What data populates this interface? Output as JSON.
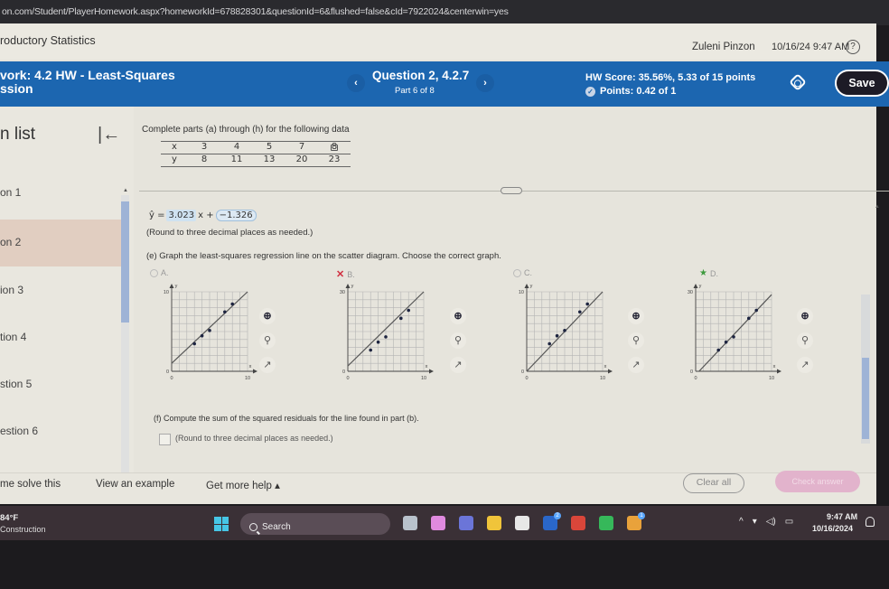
{
  "browser": {
    "url": "on.com/Student/PlayerHomework.aspx?homeworkId=678828301&questionId=6&flushed=false&cId=7922024&centerwin=yes"
  },
  "course_bar": {
    "title": "roductory Statistics",
    "user": "Zuleni Pinzon",
    "datetime": "10/16/24 9:47 AM",
    "help_glyph": "?"
  },
  "hw_bar": {
    "title_line1": "vork:  4.2 HW - Least-Squares",
    "title_line2": "ssion",
    "prev_glyph": "‹",
    "next_glyph": "›",
    "question": "Question 2, 4.2.7",
    "part": "Part 6 of 8",
    "hw_score": "HW Score: 35.56%, 5.33 of 15 points",
    "points": "Points: 0.42 of 1",
    "points_icon": "partial-credit-icon",
    "save_label": "Save",
    "accent": "#1c66b0"
  },
  "sidebar": {
    "title": "n list",
    "collapse_glyph": "|←",
    "items": [
      {
        "label": "on 1",
        "active": false
      },
      {
        "label": "on 2",
        "active": true
      },
      {
        "label": "ion 3",
        "active": false
      },
      {
        "label": "tion 4",
        "active": false
      },
      {
        "label": "stion 5",
        "active": false
      },
      {
        "label": "estion 6",
        "active": false
      }
    ]
  },
  "question": {
    "prompt": "Complete parts (a) through (h) for the following data",
    "table": {
      "x_label": "x",
      "y_label": "y",
      "x": [
        "3",
        "4",
        "5",
        "7",
        "8"
      ],
      "y": [
        "8",
        "11",
        "13",
        "20",
        "23"
      ]
    },
    "equation": {
      "lhs": "ŷ =",
      "slope": "3.023",
      "mid": "x +",
      "intercept": "−1.326"
    },
    "round_note": "(Round to three decimal places as needed.)",
    "part_e": "(e) Graph the least-squares regression line on the scatter diagram. Choose the correct graph.",
    "options": [
      {
        "letter": "A.",
        "mark": "radio",
        "y_max": "10",
        "x_max": "10",
        "x_zero": "0",
        "y_zero": "0"
      },
      {
        "letter": "B.",
        "mark": "incorrect",
        "y_max": "30",
        "x_max": "10",
        "x_zero": "0",
        "y_zero": "0"
      },
      {
        "letter": "C.",
        "mark": "radio",
        "y_max": "10",
        "x_max": "10",
        "x_zero": "0",
        "y_zero": "0"
      },
      {
        "letter": "D.",
        "mark": "correct",
        "y_max": "30",
        "x_max": "10",
        "x_zero": "0",
        "y_zero": "0"
      }
    ],
    "axis_x": "x",
    "axis_y": "y",
    "part_f": "(f) Compute the sum of the squared residuals for the line found in part (b).",
    "answer_value": "",
    "round_note_2": "(Round to three decimal places as needed.)"
  },
  "bottom_bar": {
    "help_solve": "me solve this",
    "view_example": "View an example",
    "more_help": "Get more help ▴",
    "clear_all": "Clear all",
    "check_answer": "Check answer"
  },
  "taskbar": {
    "weather_temp": "84°F",
    "weather_desc": "Construction",
    "search_label": "Search",
    "tray_chevron": "^",
    "clock_time": "9:47 AM",
    "clock_date": "10/16/2024",
    "apps": [
      {
        "name": "task-view",
        "color": "#b9c2cc",
        "badge": ""
      },
      {
        "name": "copilot",
        "color": "#e08adf",
        "badge": ""
      },
      {
        "name": "teams",
        "color": "#6b75d8",
        "badge": ""
      },
      {
        "name": "file-explorer",
        "color": "#f0c43a",
        "badge": ""
      },
      {
        "name": "microsoft-store",
        "color": "#e7e7e7",
        "badge": ""
      },
      {
        "name": "linkedin",
        "color": "#2a67c9",
        "badge": "2"
      },
      {
        "name": "office",
        "color": "#d9463a",
        "badge": ""
      },
      {
        "name": "spotify",
        "color": "#36b85a",
        "badge": ""
      },
      {
        "name": "chrome",
        "color": "#e9a23b",
        "badge": "1"
      }
    ]
  }
}
